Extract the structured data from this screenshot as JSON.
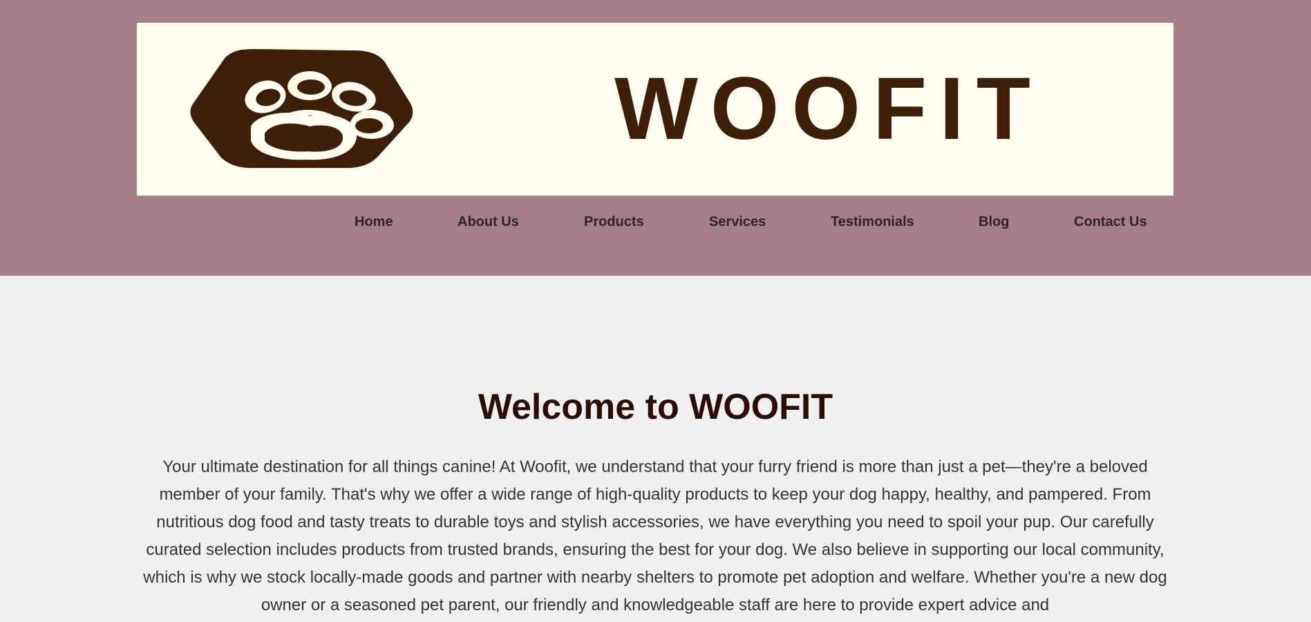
{
  "brand": {
    "logo_text": "WOOFIT",
    "logo_icon": "paw-icon",
    "colors": {
      "header_bg": "#a57e8a",
      "logo_bg": "#fffdf0",
      "logo_ink": "#3d1f08",
      "page_bg": "#f0f0f0",
      "heading": "#2b0d08",
      "body_text": "#333333"
    }
  },
  "nav": {
    "items": [
      {
        "label": "Home"
      },
      {
        "label": "About Us"
      },
      {
        "label": "Products"
      },
      {
        "label": "Services"
      },
      {
        "label": "Testimonials"
      },
      {
        "label": "Blog"
      },
      {
        "label": "Contact Us"
      }
    ]
  },
  "main": {
    "title": "Welcome to WOOFIT",
    "intro": "Your ultimate destination for all things canine! At Woofit, we understand that your furry friend is more than just a pet—they're a beloved member of your family. That's why we offer a wide range of high-quality products to keep your dog happy, healthy, and pampered. From nutritious dog food and tasty treats to durable toys and stylish accessories, we have everything you need to spoil your pup. Our carefully curated selection includes products from trusted brands, ensuring the best for your dog. We also believe in supporting our local community, which is why we stock locally-made goods and partner with nearby shelters to promote pet adoption and welfare. Whether you're a new dog owner or a seasoned pet parent, our friendly and knowledgeable staff are here to provide expert advice and"
  }
}
